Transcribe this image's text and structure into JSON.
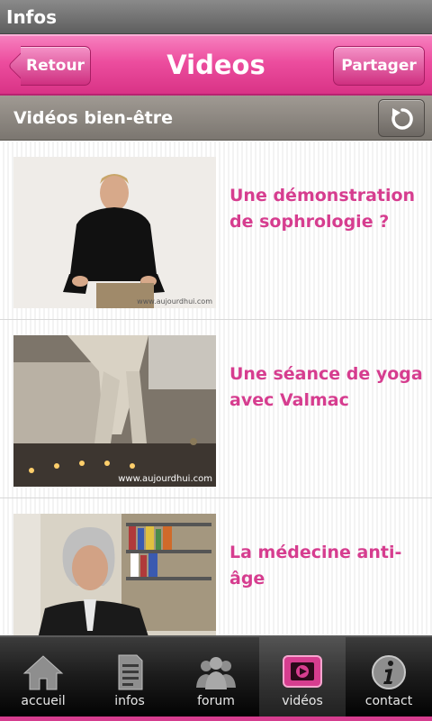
{
  "statusbar": {
    "title": "Infos"
  },
  "header": {
    "title": "Videos",
    "back_label": "Retour",
    "share_label": "Partager"
  },
  "section": {
    "title": "Vidéos bien-être",
    "refresh_icon": "refresh-icon"
  },
  "videos": [
    {
      "title": "Une démonstration de sophrologie ?",
      "watermark": "www.aujourdhui.com"
    },
    {
      "title": "Une séance de yoga avec Valmac",
      "watermark": "www.aujourdhui.com"
    },
    {
      "title": "La médecine anti-âge",
      "watermark": ""
    }
  ],
  "tabs": [
    {
      "label": "accueil",
      "icon": "home-icon",
      "active": false
    },
    {
      "label": "infos",
      "icon": "document-icon",
      "active": false
    },
    {
      "label": "forum",
      "icon": "people-icon",
      "active": false
    },
    {
      "label": "vidéos",
      "icon": "video-icon",
      "active": true
    },
    {
      "label": "contact",
      "icon": "info-icon",
      "active": false
    }
  ],
  "colors": {
    "accent": "#d63d8f",
    "header_pink": "#ec4d9e",
    "section_gray": "#8c8780",
    "tabbar_dark": "#1c1c1c"
  }
}
